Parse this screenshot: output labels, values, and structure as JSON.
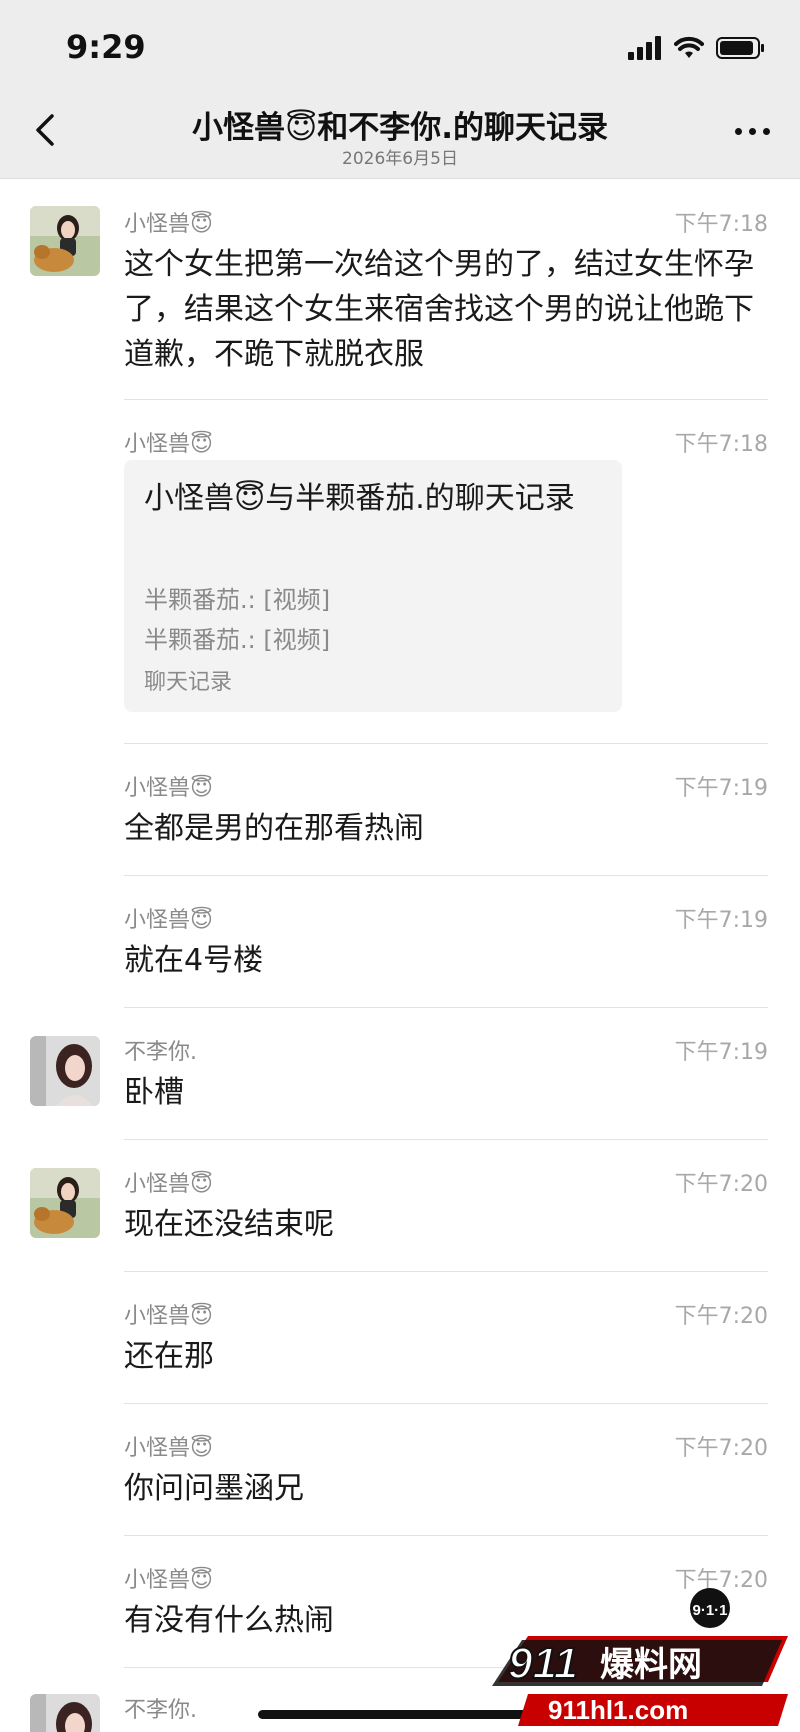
{
  "status_bar": {
    "time": "9:29",
    "icons": [
      "signal-icon",
      "wifi-icon",
      "battery-icon"
    ]
  },
  "nav": {
    "back_icon": "chevron-left-icon",
    "title": "小怪兽😇和不李你.的聊天记录",
    "subtitle": "2026年6月5日",
    "more_icon": "more-icon"
  },
  "messages": [
    {
      "sender": "小怪兽😇",
      "time": "下午7:18",
      "text": "这个女生把第一次给这个男的了，结过女生怀孕了，结果这个女生来宿舍找这个男的说让他跪下道歉，不跪下就脱衣服"
    },
    {
      "sender": "小怪兽😇",
      "time": "下午7:18",
      "card": {
        "title": "小怪兽😇与半颗番茄.的聊天记录",
        "lines": [
          "半颗番茄.: [视频]",
          "半颗番茄.: [视频]"
        ],
        "footer": "聊天记录"
      }
    },
    {
      "sender": "小怪兽😇",
      "time": "下午7:19",
      "text": "全都是男的在那看热闹"
    },
    {
      "sender": "小怪兽😇",
      "time": "下午7:19",
      "text": "就在4号楼"
    },
    {
      "sender": "不李你.",
      "time": "下午7:19",
      "text": "卧槽"
    },
    {
      "sender": "小怪兽😇",
      "time": "下午7:20",
      "text": "现在还没结束呢"
    },
    {
      "sender": "小怪兽😇",
      "time": "下午7:20",
      "text": "还在那"
    },
    {
      "sender": "小怪兽😇",
      "time": "下午7:20",
      "text": "你问问墨涵兄"
    },
    {
      "sender": "小怪兽😇",
      "time": "下午7:20",
      "text": "有没有什么热闹"
    },
    {
      "sender": "不李你.",
      "time": ""
    }
  ],
  "watermark": {
    "badge": "9·1·1",
    "brand": "911爆料网",
    "domain": "911hl1.com"
  }
}
